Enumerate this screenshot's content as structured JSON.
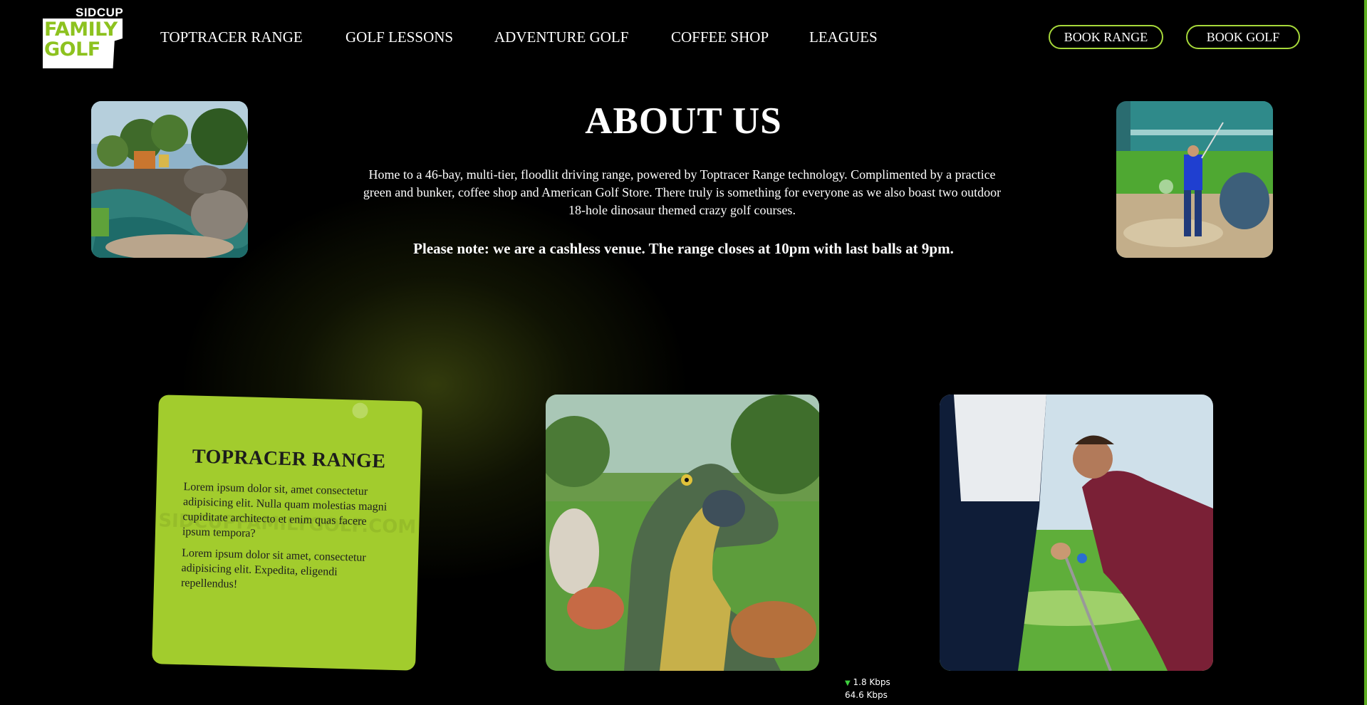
{
  "logo": {
    "top": "SIDCUP",
    "line1": "FAMILY",
    "line2": "GOLF"
  },
  "nav": {
    "items": [
      {
        "label": "TOPTRACER RANGE"
      },
      {
        "label": "GOLF LESSONS"
      },
      {
        "label": "ADVENTURE GOLF"
      },
      {
        "label": "COFFEE SHOP"
      },
      {
        "label": "LEAGUES"
      }
    ],
    "book_range": "BOOK RANGE",
    "book_golf": "BOOK GOLF"
  },
  "about": {
    "title": "ABOUT US",
    "text": "Home to a 46-bay, multi-tier, floodlit driving range, powered by Toptracer Range technology. Complimented by a practice green and bunker, coffee shop and American Golf Store. There truly is something for everyone as we also boast two outdoor 18-hole dinosaur themed crazy golf courses.",
    "note": "Please note: we are a cashless venue. The range closes at 10pm with last balls at 9pm."
  },
  "card": {
    "title": "TOPRACER RANGE",
    "p1": "Lorem ipsum dolor sit, amet consectetur adipisicing elit. Nulla quam molestias magni cupiditate architecto et enim quas facere ipsum tempora?",
    "p2": "Lorem ipsum dolor sit amet, consectetur adipisicing elit. Expedita, eligendi repellendus!",
    "watermark": "SIDCUPFAMILYGOLF.COM"
  },
  "speed": {
    "down": "1.8 Kbps",
    "up": "64.6 Kbps"
  },
  "colors": {
    "accent": "#a2cc2d",
    "button_border": "#a6d83a",
    "background": "#000000"
  }
}
